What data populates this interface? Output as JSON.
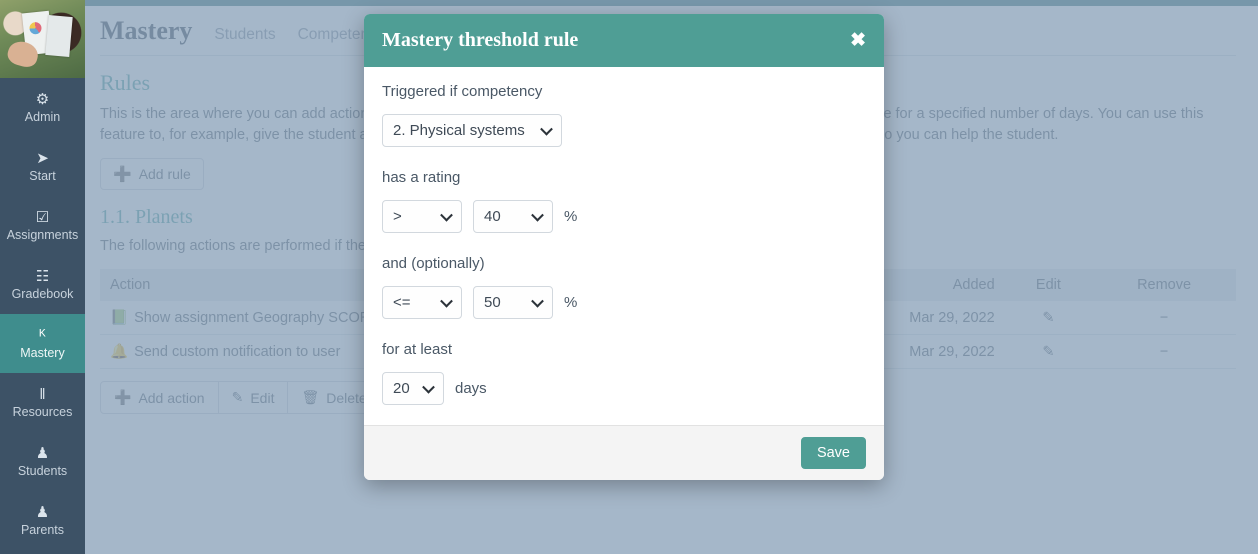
{
  "sidebar": {
    "items": [
      {
        "label": "Admin",
        "icon": "gear-icon",
        "glyph": "⚙",
        "active": false
      },
      {
        "label": "Start",
        "icon": "navigate-icon",
        "glyph": "➤",
        "active": false
      },
      {
        "label": "Assignments",
        "icon": "checkbox-icon",
        "glyph": "☑",
        "active": false
      },
      {
        "label": "Gradebook",
        "icon": "gradebook-icon",
        "glyph": "☷",
        "active": false
      },
      {
        "label": "Mastery",
        "icon": "bar-chart-icon",
        "glyph": "ᴷ",
        "active": true
      },
      {
        "label": "Resources",
        "icon": "books-icon",
        "glyph": "‖",
        "active": false
      },
      {
        "label": "Students",
        "icon": "person-icon",
        "glyph": "♟",
        "active": false
      },
      {
        "label": "Parents",
        "icon": "person-icon",
        "glyph": "♟",
        "active": false
      }
    ]
  },
  "header": {
    "title": "Mastery",
    "tabs": [
      {
        "label": "Students"
      },
      {
        "label": "Competencies"
      }
    ]
  },
  "main": {
    "rules_heading": "Rules",
    "rules_paragraph": "This is the area where you can add actions that are performed if a student has a competency rating within a specified range for a specified number of days. You can use this feature to, for example, give the student advice on how to improve in that area, unlock advanced modules, or to alert you so you can help the student.",
    "add_rule_label": "Add rule",
    "add_rule_icon": "plus-icon",
    "planets_heading": "1.1. Planets",
    "planets_paragraph": "The following actions are performed if the competency rating is in the specified range:",
    "table": {
      "columns": [
        "Action",
        "Added",
        "Edit",
        "Remove"
      ],
      "rows": [
        {
          "icon": "assignment-icon",
          "action": "Show assignment Geography SCORM to student",
          "added": "Mar 29, 2022",
          "edit_icon": "pencil-icon",
          "remove_icon": "minus-icon"
        },
        {
          "icon": "bell-icon",
          "action": "Send custom notification to user",
          "added": "Mar 29, 2022",
          "edit_icon": "pencil-icon",
          "remove_icon": "minus-icon"
        }
      ]
    },
    "action_buttons": [
      {
        "label": "Add action",
        "icon": "plus-icon"
      },
      {
        "label": "Edit",
        "icon": "pencil-icon"
      },
      {
        "label": "Delete",
        "icon": "trash-icon"
      }
    ]
  },
  "modal": {
    "title": "Mastery threshold rule",
    "close_icon": "close-icon",
    "label_competency": "Triggered if competency",
    "competency_value": "2. Physical systems",
    "label_rating": "has a rating",
    "operator1_value": ">",
    "value1": "40",
    "percent_sign": "%",
    "label_optional": "and (optionally)",
    "operator2_value": "<=",
    "value2": "50",
    "percent_sign2": "%",
    "label_duration": "for at least",
    "days_value": "20",
    "days_unit": "days",
    "save_label": "Save"
  },
  "colors": {
    "accent_teal": "#4f9e95",
    "topbar_teal": "#2f6f74",
    "sidebar": "#3d5266",
    "sidebar_active": "#3f8d8d",
    "heading_teal": "#3f9a9a",
    "overlay": "#8ca3ba"
  }
}
